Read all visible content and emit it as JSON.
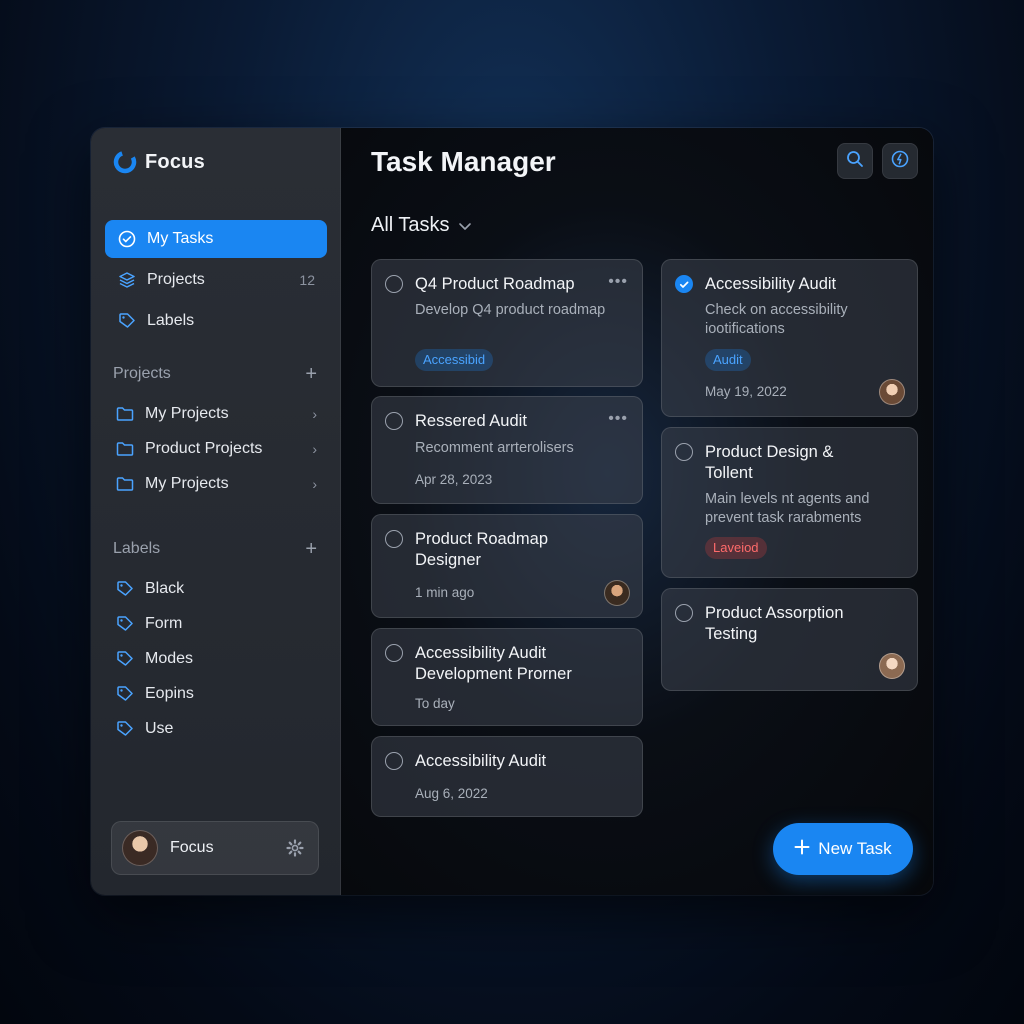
{
  "app": {
    "name": "Focus",
    "title": "Task Manager"
  },
  "colors": {
    "accent": "#1a86f2",
    "tag_blue": "#4aa3ff",
    "tag_red": "#ff6b6b"
  },
  "sidebar": {
    "nav": [
      {
        "label": "My Tasks",
        "icon": "check-circle-icon",
        "count": "",
        "active": true
      },
      {
        "label": "Projects",
        "icon": "layers-icon",
        "count": "12",
        "active": false
      },
      {
        "label": "Labels",
        "icon": "tag-icon",
        "count": "",
        "active": false
      }
    ],
    "projects_heading": "Projects",
    "projects": [
      {
        "label": "My Projects",
        "icon": "folder-icon"
      },
      {
        "label": "Product Projects",
        "icon": "folder-icon"
      },
      {
        "label": "My Projects",
        "icon": "folder-icon"
      }
    ],
    "labels_heading": "Labels",
    "labels": [
      {
        "label": "Black",
        "icon": "tag-icon"
      },
      {
        "label": "Form",
        "icon": "tag-icon"
      },
      {
        "label": "Modes",
        "icon": "tag-icon"
      },
      {
        "label": "Eopins",
        "icon": "tag-icon"
      },
      {
        "label": "Use",
        "icon": "tag-icon"
      }
    ],
    "user": {
      "name": "Focus"
    }
  },
  "main": {
    "filter_label": "All Tasks",
    "new_task_label": "New Task",
    "left_column": [
      {
        "title": "Q4 Product Roadmap",
        "description": "Develop Q4 product roadmap",
        "tag": "Accessibid",
        "done": false
      },
      {
        "title": "Ressered Audit",
        "description": "Recomment arrterolisers",
        "date": "Apr 28, 2023",
        "done": false
      },
      {
        "title": "Product Roadmap Designer",
        "date": "1 min ago",
        "done": false
      },
      {
        "title": "Accessibility Audit Development Prorner",
        "date": "To day",
        "done": false
      },
      {
        "title": "Accessibility Audit",
        "date": "Aug 6, 2022",
        "done": false
      }
    ],
    "right_column": [
      {
        "title": "Accessibility Audit",
        "description": "Check on accessibility iootifications",
        "tag": "Audit",
        "date": "May 19, 2022",
        "done": true
      },
      {
        "title": "Product Design & Tollent",
        "description": "Main levels nt agents and prevent task rarabments",
        "tag": "Laveiod",
        "done": false
      },
      {
        "title": "Product Assorption Testing",
        "done": false
      }
    ]
  }
}
